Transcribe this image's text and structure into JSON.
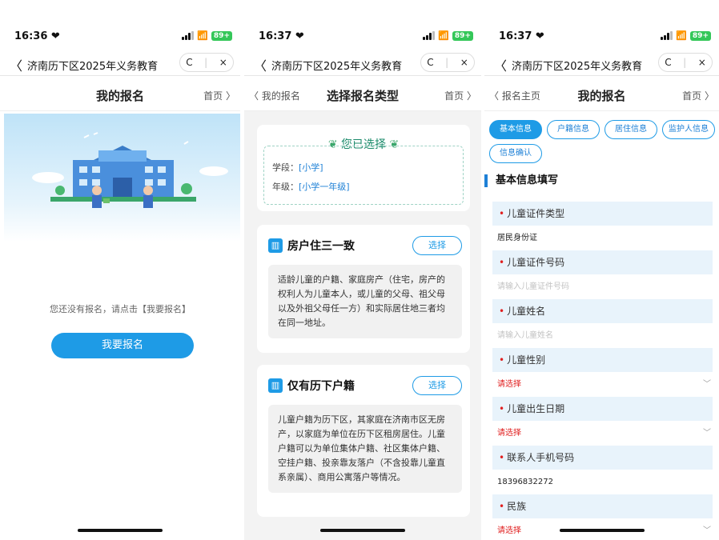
{
  "phones": [
    {
      "status": {
        "time": "16:36 ❤",
        "battery": "89+"
      },
      "address_bar": {
        "title": "济南历下区2025年义务教育",
        "refresh": "C",
        "close": "×"
      },
      "navbar": {
        "title": "我的报名",
        "right": "首页 〉"
      },
      "empty_message": "您还没有报名，请点击【我要报名】",
      "register_button": "我要报名"
    },
    {
      "status": {
        "time": "16:37 ❤",
        "battery": "89+"
      },
      "address_bar": {
        "title": "济南历下区2025年义务教育",
        "refresh": "C",
        "close": "×"
      },
      "navbar": {
        "left": "〈 我的报名",
        "title": "选择报名类型",
        "right": "首页 〉"
      },
      "selected": {
        "title": "您已选择",
        "stage_label": "学段：",
        "stage_value": "[小学]",
        "grade_label": "年级：",
        "grade_value": "[小学一年级]"
      },
      "options": [
        {
          "title": "房户住三一致",
          "button": "选择",
          "icon": "building-icon",
          "desc": "适龄儿童的户籍、家庭房产（住宅，房产的权利人为儿童本人，或儿童的父母、祖父母以及外祖父母任一方）和实际居住地三者均在同一地址。"
        },
        {
          "title": "仅有历下户籍",
          "button": "选择",
          "icon": "building-icon",
          "desc": "儿童户籍为历下区，其家庭在济南市区无房产，以家庭为单位在历下区租房居住。儿童户籍可以为单位集体户籍、社区集体户籍、空挂户籍、投亲靠友落户（不含投靠儿童直系亲属）、商用公寓落户等情况。"
        }
      ]
    },
    {
      "status": {
        "time": "16:37 ❤",
        "battery": "89+"
      },
      "address_bar": {
        "title": "济南历下区2025年义务教育",
        "refresh": "C",
        "close": "×"
      },
      "navbar": {
        "left": "〈 报名主页",
        "title": "我的报名",
        "right": "首页 〉"
      },
      "tabs": [
        "基本信息",
        "户籍信息",
        "居住信息",
        "监护人信息",
        "信息确认"
      ],
      "active_tab": 0,
      "section_title": "基本信息填写",
      "fields": [
        {
          "label": "儿童证件类型",
          "value": "居民身份证",
          "kind": "value"
        },
        {
          "label": "儿童证件号码",
          "value": "请输入儿童证件号码",
          "kind": "placeholder"
        },
        {
          "label": "儿童姓名",
          "value": "请输入儿童姓名",
          "kind": "placeholder"
        },
        {
          "label": "儿童性别",
          "value": "请选择",
          "kind": "select"
        },
        {
          "label": "儿童出生日期",
          "value": "请选择",
          "kind": "select"
        },
        {
          "label": "联系人手机号码",
          "value": "18396832272",
          "kind": "value"
        },
        {
          "label": "民族",
          "value": "请选择",
          "kind": "select"
        }
      ],
      "required_mark": "•"
    }
  ],
  "colors": {
    "primary": "#1e9be6",
    "required": "#e02020",
    "field_bg": "#e8f3fb",
    "battery": "#34c759"
  }
}
